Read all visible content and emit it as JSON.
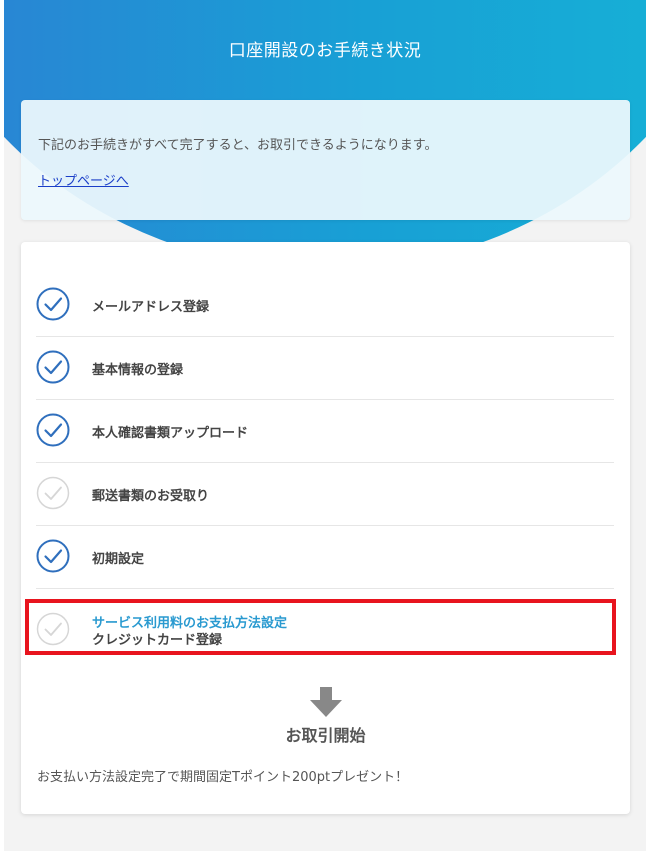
{
  "header": {
    "title": "口座開設のお手続き状況"
  },
  "info": {
    "message": "下記のお手続きがすべて完了すると、お取引できるようになります。",
    "top_link": "トップページへ"
  },
  "steps": [
    {
      "label": "メールアドレス登録",
      "status": "complete"
    },
    {
      "label": "基本情報の登録",
      "status": "complete"
    },
    {
      "label": "本人確認書類アップロード",
      "status": "complete"
    },
    {
      "label": "郵送書類のお受取り",
      "status": "pending"
    },
    {
      "label": "初期設定",
      "status": "complete"
    }
  ],
  "highlighted_step": {
    "title": "サービス利用料のお支払方法設定",
    "subtitle": "クレジットカード登録",
    "status": "pending"
  },
  "finish": {
    "label": "お取引開始",
    "promo": "お支払い方法設定完了で期間固定Tポイント200ptプレゼント！"
  },
  "colors": {
    "complete": "#2f6fbd",
    "pending": "#d6d6d6",
    "highlight_border": "#e8141e",
    "link": "#1a3ec8",
    "accent_text": "#2a9ad0"
  },
  "icons": {
    "complete": "check-circle-icon",
    "pending": "check-circle-outline-icon",
    "arrow": "arrow-down-icon"
  }
}
